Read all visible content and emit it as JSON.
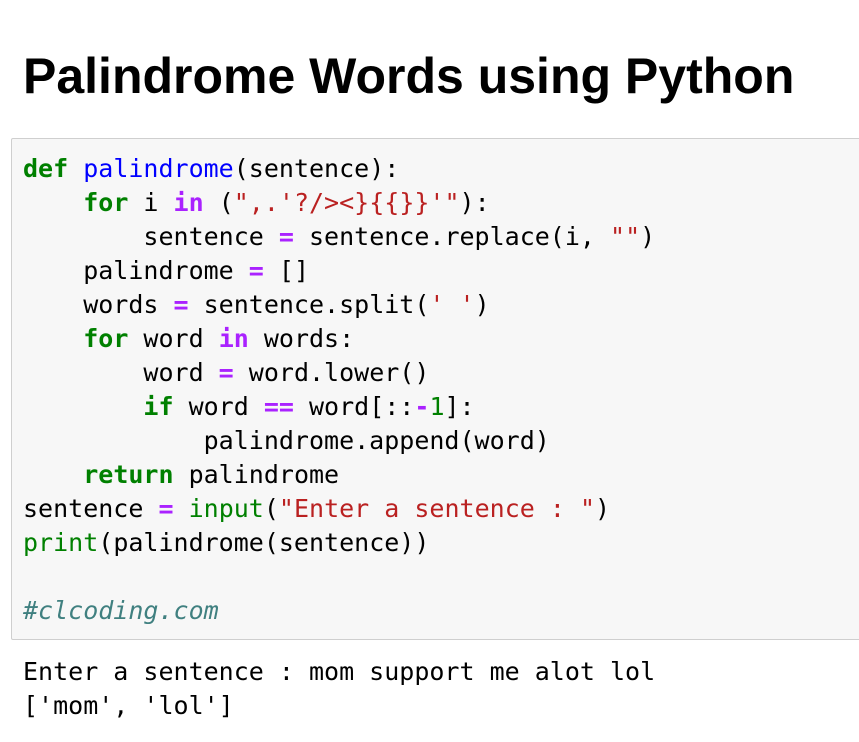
{
  "title": "Palindrome Words using Python",
  "code": {
    "l1": {
      "t1": "def",
      "t2": " ",
      "t3": "palindrome",
      "t4": "(sentence):"
    },
    "l2": {
      "t1": "    ",
      "t2": "for",
      "t3": " i ",
      "t4": "in",
      "t5": " (",
      "t6": "\",.'?/><}{{}}'\"",
      "t7": "):"
    },
    "l3": {
      "t1": "        sentence ",
      "t2": "=",
      "t3": " sentence.replace(i, ",
      "t4": "\"\"",
      "t5": ")"
    },
    "l4": {
      "t1": "    palindrome ",
      "t2": "=",
      "t3": " []"
    },
    "l5": {
      "t1": "    words ",
      "t2": "=",
      "t3": " sentence.split(",
      "t4": "' '",
      "t5": ")"
    },
    "l6": {
      "t1": "    ",
      "t2": "for",
      "t3": " word ",
      "t4": "in",
      "t5": " words:"
    },
    "l7": {
      "t1": "        word ",
      "t2": "=",
      "t3": " word.lower()"
    },
    "l8": {
      "t1": "        ",
      "t2": "if",
      "t3": " word ",
      "t4": "==",
      "t5": " word[::",
      "t6": "-",
      "t7": "1",
      "t8": "]:"
    },
    "l9": {
      "t1": "            palindrome.append(word)"
    },
    "l10": {
      "t1": "    ",
      "t2": "return",
      "t3": " palindrome"
    },
    "l11": {
      "t1": "sentence ",
      "t2": "=",
      "t3": " ",
      "t4": "input",
      "t5": "(",
      "t6": "\"Enter a sentence : \"",
      "t7": ")"
    },
    "l12": {
      "t1": "print",
      "t2": "(palindrome(sentence))"
    },
    "l13": {
      "t1": ""
    },
    "l14": {
      "t1": "#clcoding.com"
    }
  },
  "output": {
    "line1": "Enter a sentence : mom support me alot lol",
    "line2": "['mom', 'lol']"
  }
}
